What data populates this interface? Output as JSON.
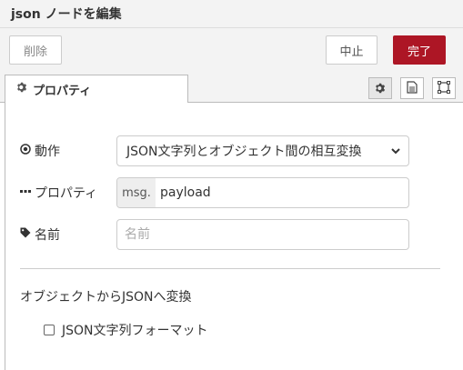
{
  "header": {
    "title": "json ノードを編集"
  },
  "toolbar": {
    "delete_label": "削除",
    "cancel_label": "中止",
    "done_label": "完了"
  },
  "tabs": {
    "properties_label": "プロパティ",
    "icons": [
      "gear-icon",
      "document-icon",
      "frame-icon"
    ]
  },
  "form": {
    "action": {
      "label": "動作",
      "value": "JSON文字列とオブジェクト間の相互変換"
    },
    "property": {
      "label": "プロパティ",
      "prefix": "msg.",
      "value": "payload"
    },
    "name": {
      "label": "名前",
      "placeholder": "名前",
      "value": ""
    }
  },
  "section": {
    "title": "オブジェクトからJSONへ変換",
    "checkbox_label": "JSON文字列フォーマット",
    "checked": false
  },
  "colors": {
    "done_button": "#ad1625",
    "header_bg": "#f3f3f3"
  }
}
